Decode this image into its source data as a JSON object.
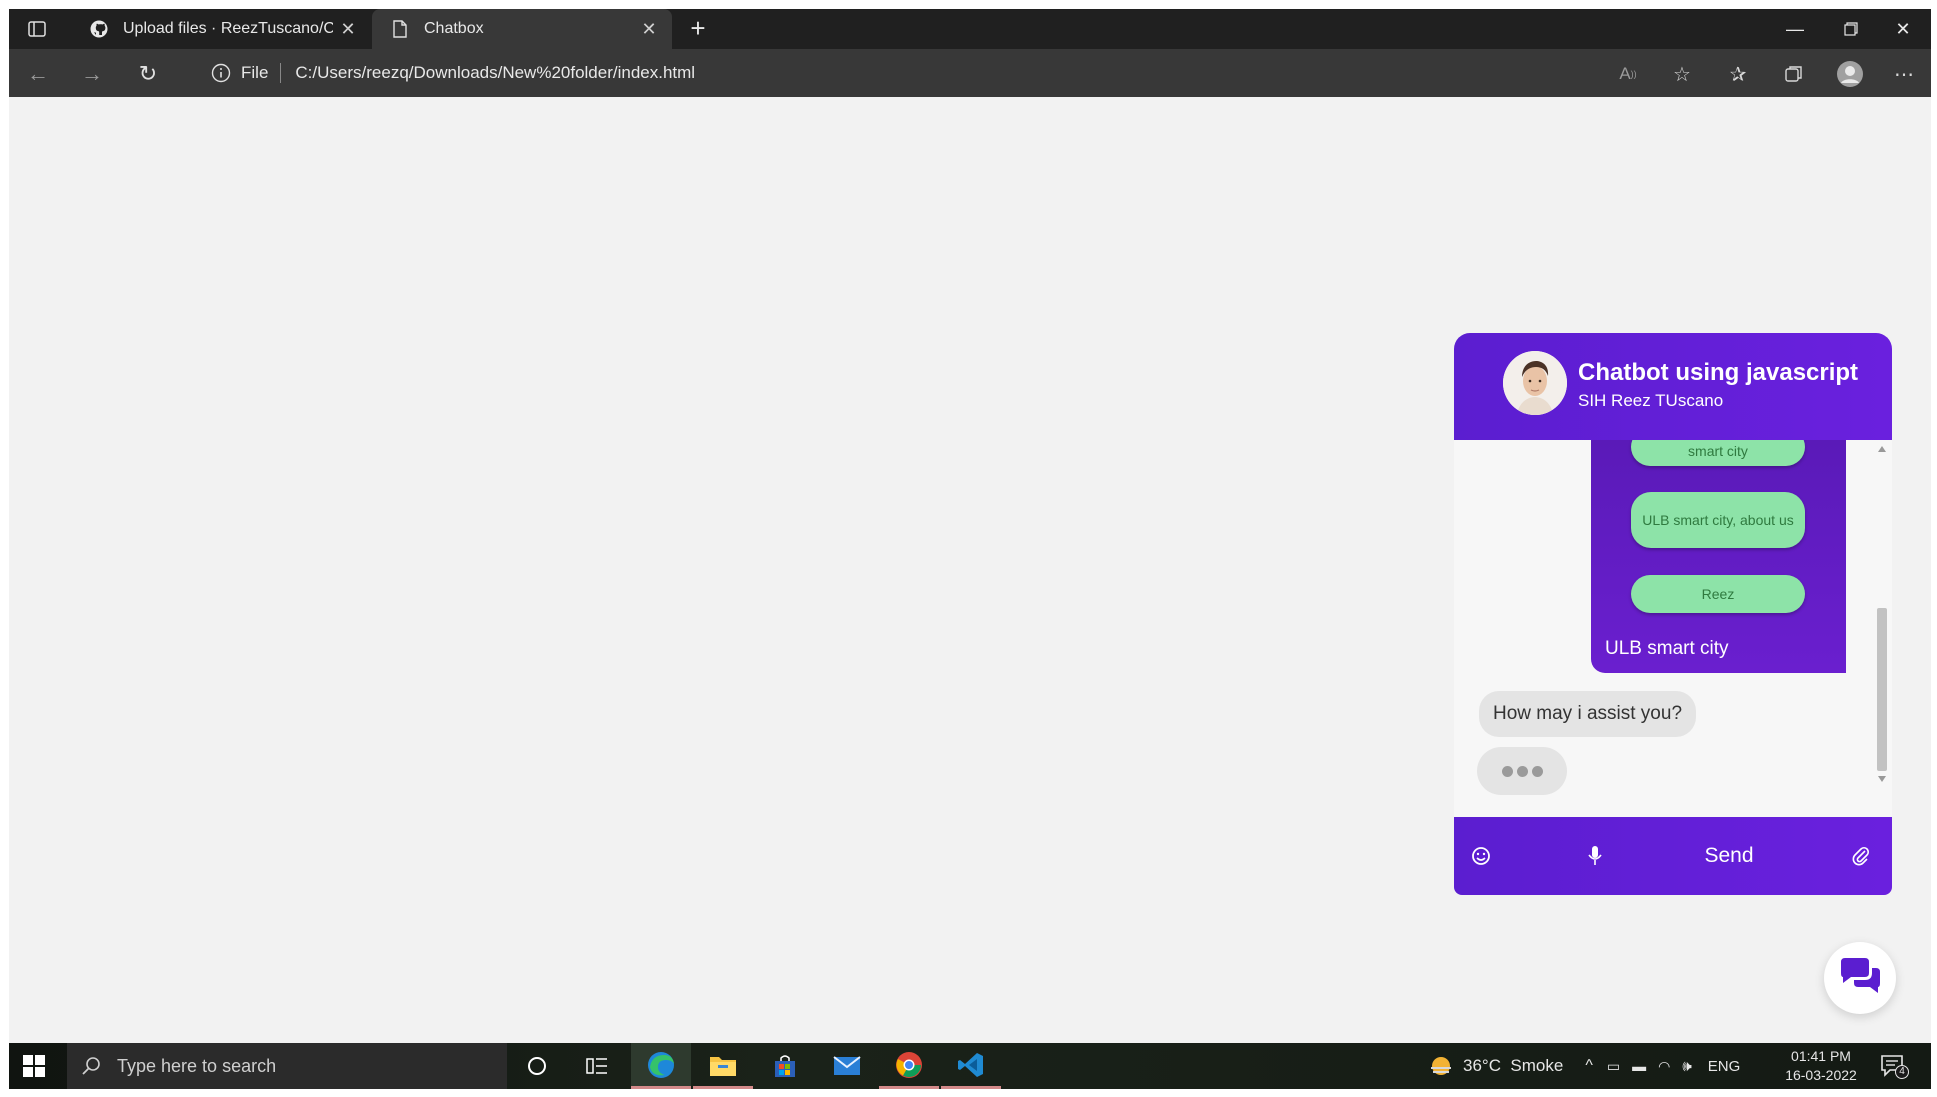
{
  "browser": {
    "tabs": [
      {
        "label": "Upload files · ReezTuscano/Chatl",
        "icon": "github-icon"
      },
      {
        "label": "Chatbox",
        "icon": "page-icon"
      }
    ],
    "address": {
      "scheme_label": "File",
      "url": "C:/Users/reezq/Downloads/New%20folder/index.html"
    }
  },
  "chat": {
    "title": "Chatbot using javascript",
    "subtitle": "SIH Reez TUscano",
    "options": [
      "smart city",
      "ULB smart city, about us",
      "Reez"
    ],
    "user_message": "ULB smart city",
    "bot_message": "How may i assist you?",
    "send_label": "Send",
    "colors": {
      "header": "#5b1ed0",
      "option_bg": "#8de3a8",
      "option_text": "#2f7a3f",
      "bubble": "#e4e4e4"
    }
  },
  "taskbar": {
    "search_placeholder": "Type here to search",
    "weather": "36°C  Smoke",
    "language": "ENG",
    "time": "01:41 PM",
    "date": "16-03-2022",
    "notification_count": "4"
  }
}
